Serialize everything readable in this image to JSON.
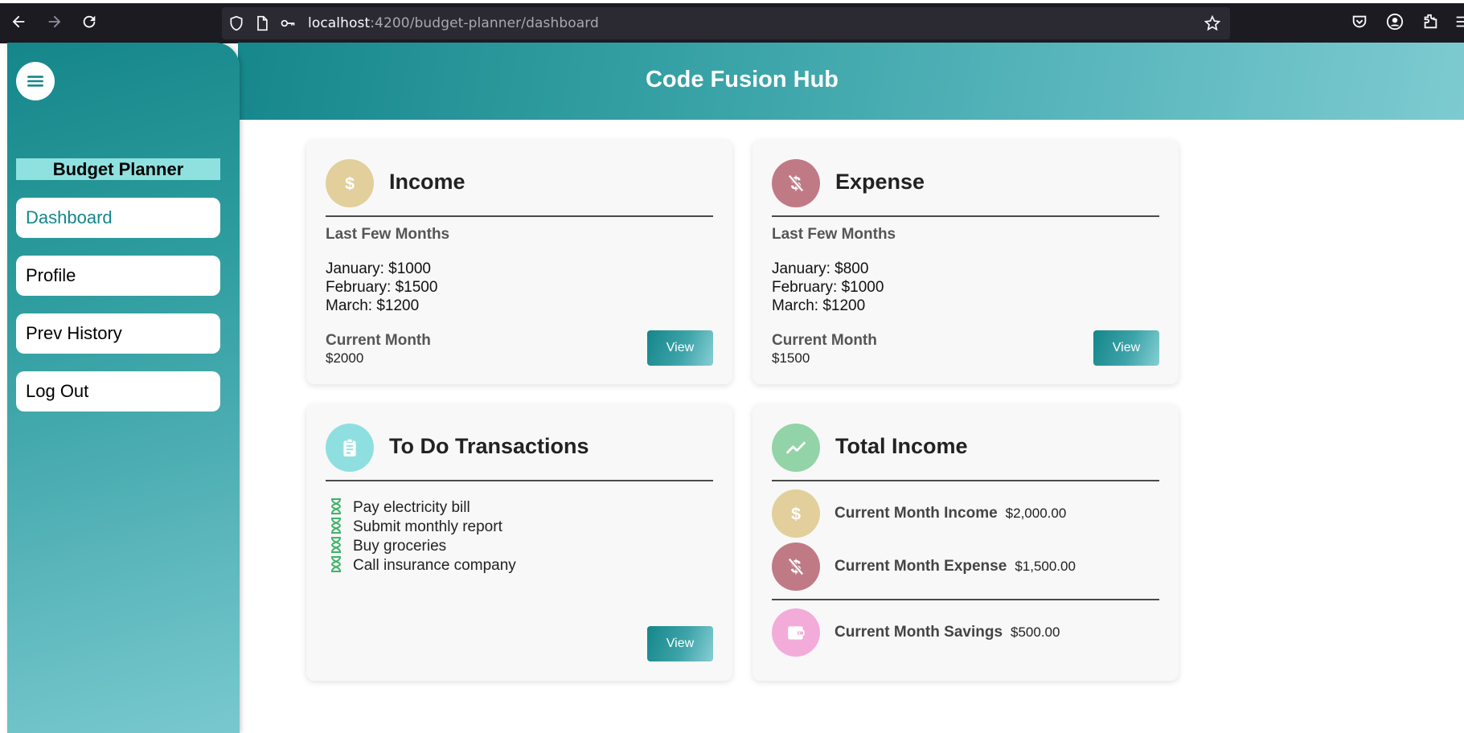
{
  "browser": {
    "url_host": "localhost",
    "url_rest": ":4200/budget-planner/dashboard"
  },
  "sidebar": {
    "title": "Budget Planner",
    "items": [
      {
        "label": "Dashboard",
        "active": true
      },
      {
        "label": "Profile",
        "active": false
      },
      {
        "label": "Prev History",
        "active": false
      },
      {
        "label": "Log Out",
        "active": false
      }
    ]
  },
  "header": {
    "title": "Code Fusion Hub"
  },
  "income": {
    "title": "Income",
    "icon": "dollar-icon",
    "subhead": "Last Few Months",
    "months": [
      "January: $1000",
      "February: $1500",
      "March: $1200"
    ],
    "current_label": "Current Month",
    "current_value": "$2000",
    "button": "View",
    "color": "#e2cf9b"
  },
  "expense": {
    "title": "Expense",
    "icon": "money-off-icon",
    "subhead": "Last Few Months",
    "months": [
      "January: $800",
      "February: $1000",
      "March: $1200"
    ],
    "current_label": "Current Month",
    "current_value": "$1500",
    "button": "View",
    "color": "#c07a86"
  },
  "todo": {
    "title": "To Do Transactions",
    "icon": "clipboard-icon",
    "items": [
      "Pay electricity bill",
      "Submit monthly report",
      "Buy groceries",
      "Call insurance company"
    ],
    "button": "View",
    "color": "#8fdfe0"
  },
  "total_income": {
    "title": "Total Income",
    "icon": "trending-up-icon",
    "color": "#93d3a8",
    "rows": [
      {
        "label": "Current Month Income",
        "value": "$2,000.00",
        "icon": "dollar-icon",
        "color": "#e2cf9b"
      },
      {
        "label": "Current Month Expense",
        "value": "$1,500.00",
        "icon": "money-off-icon",
        "color": "#c07a86"
      },
      {
        "label": "Current Month Savings",
        "value": "$500.00",
        "icon": "wallet-icon",
        "color": "#f3acd9"
      }
    ]
  }
}
